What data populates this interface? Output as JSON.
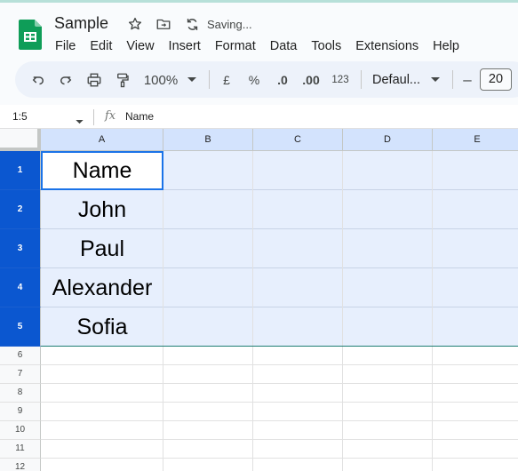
{
  "app": {
    "doc_title": "Sample",
    "status_text": "Saving...",
    "brand_color": "#0f9d58",
    "selection_color": "#0b57d0"
  },
  "menu": [
    "File",
    "Edit",
    "View",
    "Insert",
    "Format",
    "Data",
    "Tools",
    "Extensions",
    "Help"
  ],
  "toolbar": {
    "zoom": "100%",
    "currency": "£",
    "percent": "%",
    "decrease_decimal": ".0",
    "increase_decimal": ".00",
    "number_format": "123",
    "font": "Defaul...",
    "font_size_decrease": "–",
    "font_size": "20"
  },
  "formula_bar": {
    "name_box": "1:5",
    "fx": "fx",
    "value": "Name"
  },
  "sheet": {
    "columns": [
      "A",
      "B",
      "C",
      "D",
      "E"
    ],
    "rows": [
      "1",
      "2",
      "3",
      "4",
      "5",
      "6",
      "7",
      "8",
      "9",
      "10",
      "11",
      "12"
    ],
    "column_a_values": [
      "Name",
      "John",
      "Paul",
      "Alexander",
      "Sofia"
    ],
    "selected_rows": "1:5",
    "active_cell": "A1"
  }
}
